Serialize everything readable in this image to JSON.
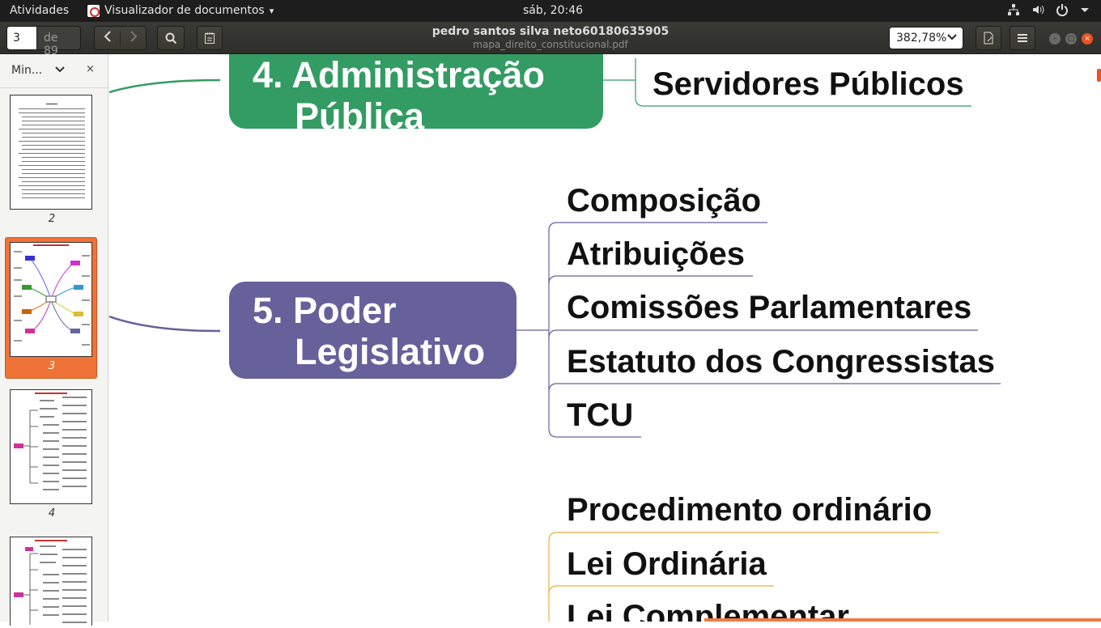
{
  "topbar": {
    "activities": "Atividades",
    "app_name": "Visualizador de documentos",
    "app_menu_arrow": "▾",
    "clock": "sáb, 20:46",
    "tray_icons": [
      "network-icon",
      "volume-icon",
      "power-icon",
      "menu-arrow-icon"
    ]
  },
  "header": {
    "page_current": "3",
    "page_total": "de 89",
    "doc_title": "pedro santos silva neto60180635905",
    "doc_filename": "mapa_direito_constitucional.pdf",
    "zoom": "382,78%"
  },
  "sidebar": {
    "view_label": "Min...",
    "thumbnails": [
      {
        "label": "2",
        "selected": false
      },
      {
        "label": "3",
        "selected": true
      },
      {
        "label": "4",
        "selected": false
      },
      {
        "label": "",
        "selected": false
      }
    ]
  },
  "document": {
    "node_admin": {
      "line1": "4. Administração",
      "line2": "Pública",
      "color": "#339c63"
    },
    "node_admin_child": "Servidores Públicos",
    "node_legislativo": {
      "line1": "5. Poder",
      "line2": "Legislativo",
      "color": "#66619a"
    },
    "legislativo_children": [
      "Composição",
      "Atribuições",
      "Comissões Parlamentares",
      "Estatuto dos Congressistas",
      "TCU"
    ],
    "processo_children": [
      "Procedimento ordinário",
      "Lei Ordinária",
      "Lei Complementar"
    ]
  },
  "colors": {
    "accent": "#e95420",
    "admin_green": "#339c63",
    "legislativo_purple": "#66619a",
    "processo_gold": "#e0b53a"
  }
}
